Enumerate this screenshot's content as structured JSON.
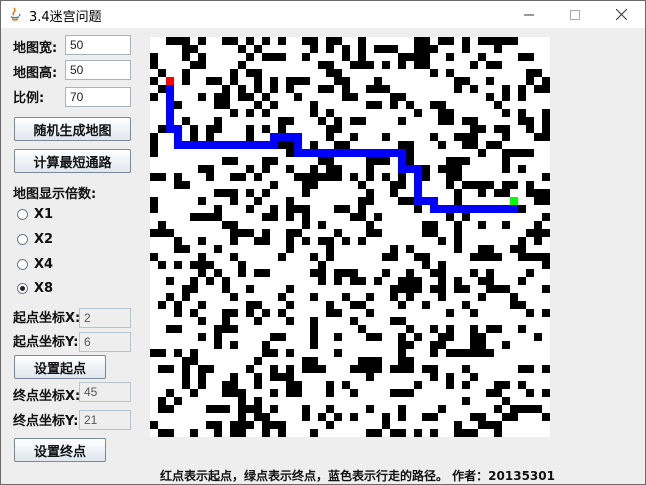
{
  "window": {
    "title": "3.4迷宫问题"
  },
  "settings": {
    "width_label": "地图宽:",
    "width_value": "50",
    "height_label": "地图高:",
    "height_value": "50",
    "ratio_label": "比例:",
    "ratio_value": "70",
    "generate_button": "随机生成地图",
    "path_button": "计算最短通路",
    "zoom_label": "地图显示倍数:",
    "zoom_options": [
      "X1",
      "X2",
      "X4",
      "X8"
    ],
    "zoom_selected": "X8"
  },
  "start": {
    "x_label": "起点坐标X:",
    "x_value": "2",
    "y_label": "起点坐标Y:",
    "y_value": "6",
    "set_button": "设置起点"
  },
  "end": {
    "x_label": "终点坐标X:",
    "x_value": "45",
    "y_label": "终点坐标Y:",
    "y_value": "21",
    "set_button": "设置终点"
  },
  "footer": "红点表示起点，绿点表示终点，蓝色表示行走的路径。 作者：20135301",
  "maze": {
    "cols": 50,
    "rows": 50,
    "scale": 8,
    "wall_density": 0.3,
    "colors": {
      "wall": "#000000",
      "floor": "#ffffff",
      "path": "#0000ff",
      "start": "#ff0000",
      "end": "#00ff00"
    }
  }
}
